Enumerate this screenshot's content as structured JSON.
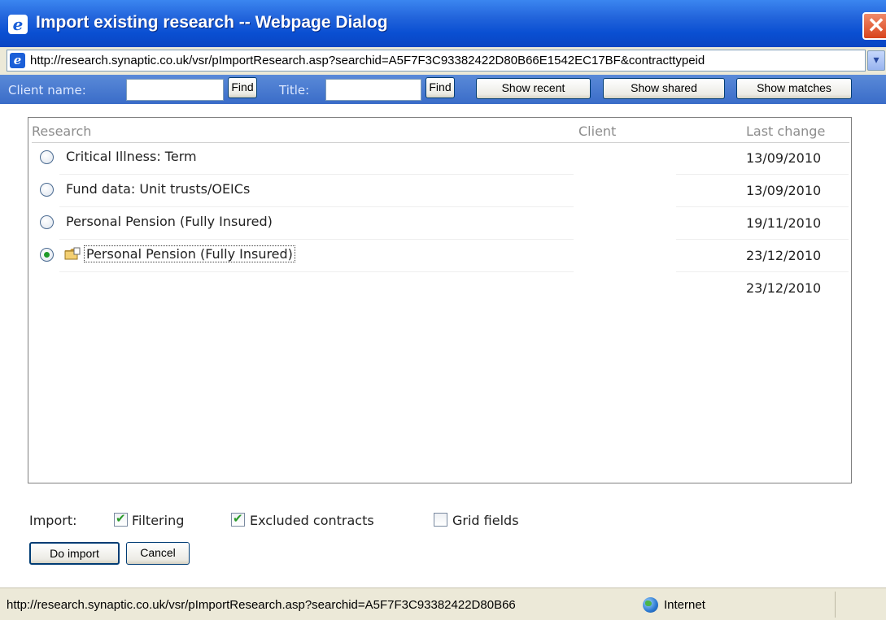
{
  "window": {
    "title": "Import existing research -- Webpage Dialog",
    "close_label": "✕",
    "address": "http://research.synaptic.co.uk/vsr/pImportResearch.asp?searchid=A5F7F3C93382422D80B66E1542EC17BF&contracttypeid",
    "address_dropdown": "▾"
  },
  "search": {
    "client_label": "Client name:",
    "client_value": "",
    "find_label": "Find",
    "title_label": "Title:",
    "title_value": "",
    "find2_label": "Find",
    "show_recent": "Show recent",
    "show_shared": "Show shared",
    "show_matches": "Show matches"
  },
  "list": {
    "headers": {
      "research": "Research",
      "client": "Client",
      "last_change": "Last change"
    },
    "rows": [
      {
        "title": "Critical Illness: Term",
        "client": "",
        "date": "13/09/2010",
        "selected": false
      },
      {
        "title": "Fund data: Unit trusts/OEICs",
        "client": "",
        "date": "13/09/2010",
        "selected": false
      },
      {
        "title": "Personal Pension (Fully Insured)",
        "client": "",
        "date": "19/11/2010",
        "selected": false
      },
      {
        "title": "Personal Pension (Fully Insured)",
        "client": "",
        "date": "23/12/2010",
        "selected": true,
        "icon": "folder-icon"
      },
      {
        "title": "",
        "client": "",
        "date": "23/12/2010",
        "selected": false
      }
    ]
  },
  "import": {
    "label": "Import:",
    "filtering": {
      "label": "Filtering",
      "checked": true
    },
    "excluded": {
      "label": "Excluded contracts",
      "checked": true
    },
    "grid": {
      "label": "Grid fields",
      "checked": false
    }
  },
  "actions": {
    "do_import": "Do import",
    "cancel": "Cancel"
  },
  "status": {
    "url": "http://research.synaptic.co.uk/vsr/pImportResearch.asp?searchid=A5F7F3C93382422D80B66",
    "zone": "Internet"
  }
}
